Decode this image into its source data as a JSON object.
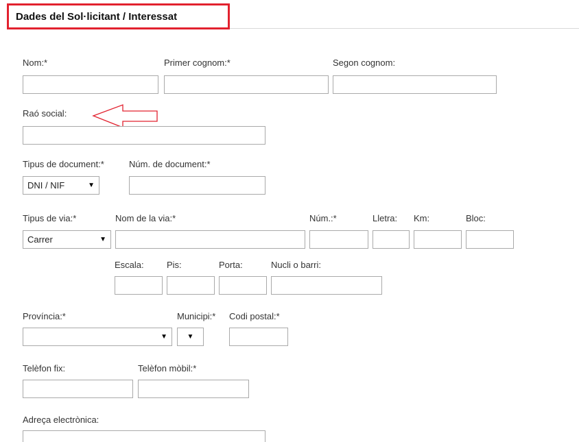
{
  "section_title": "Dades del Sol·licitant / Interessat",
  "accent_color": "#e2212e",
  "fields": {
    "nom": "Nom:*",
    "primer_cognom": "Primer cognom:*",
    "segon_cognom": "Segon cognom:",
    "rao_social": "Raó social:",
    "tipus_document": "Tipus de document:*",
    "num_document": "Núm. de document:*",
    "tipus_via": "Tipus de via:*",
    "nom_via": "Nom de la via:*",
    "num": "Núm.:*",
    "lletra": "Lletra:",
    "km": "Km:",
    "bloc": "Bloc:",
    "escala": "Escala:",
    "pis": "Pis:",
    "porta": "Porta:",
    "nucli": "Nucli o barri:",
    "provincia": "Província:*",
    "municipi": "Municipi:*",
    "codi_postal": "Codi postal:*",
    "telefon_fix": "Telèfon fix:",
    "telefon_mobil": "Telèfon mòbil:*",
    "adreca": "Adreça electrònica:"
  },
  "selects": {
    "tipus_document_value": "DNI / NIF",
    "tipus_via_value": "Carrer",
    "provincia_value": "",
    "municipi_value": ""
  },
  "icons": {
    "caret": "▼",
    "annotation": "left-arrow-outline-icon"
  }
}
